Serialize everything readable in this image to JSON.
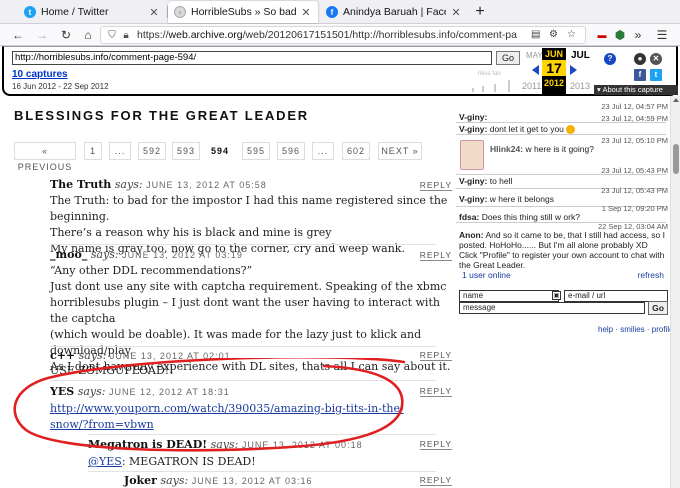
{
  "browser": {
    "tabs": [
      {
        "title": "Home / Twitter",
        "favicon": "twitter-icon"
      },
      {
        "title": "HorribleSubs » So bad yet so go",
        "favicon": "horriblesubs-icon"
      },
      {
        "title": "Anindya Baruah | Facebook",
        "favicon": "facebook-icon"
      }
    ],
    "new_tab": "+",
    "url_domain": "web.archive.org",
    "url_path": "/web/20120617151501/http://horriblesubs.info/comment-page-594/",
    "url_prefix": "https://"
  },
  "wayback": {
    "input_url": "http://horriblesubs.info/comment-page-594/",
    "go": "Go",
    "captures_label": "10 captures",
    "range": "16 Jun 2012 - 22 Sep 2012",
    "prev_month": "MAY",
    "cur_month": "JUN",
    "next_month": "JUL",
    "cur_day": "17",
    "prev_year": "2011",
    "cur_year": "2012",
    "next_year": "2013",
    "about": "About this capture"
  },
  "page": {
    "title": "BLESSINGS FOR THE GREAT LEADER",
    "pager": [
      "« PREVIOUS",
      "1",
      "...",
      "592",
      "593",
      "594",
      "595",
      "596",
      "...",
      "602",
      "NEXT »"
    ],
    "current_page": "594"
  },
  "comments": [
    {
      "author": "The Truth",
      "says": "says:",
      "date": "JUNE 13, 2012 AT 05:58",
      "reply": "REPLY",
      "lines": [
        "The Truth: to bad for the impostor I had this name registered since the beginning.",
        "There’s a reason why his is black and mine is grey",
        "My name is gray too, now go to the corner, cry and weep wank."
      ]
    },
    {
      "author": "_moo_",
      "says": "says:",
      "date": "JUNE 13, 2012 AT 03:19",
      "reply": "REPLY",
      "lines": [
        "“Any other DDL recommendations?”",
        "Just dont use any site with captcha requirement. Speaking of the xbmc",
        "horriblesubs plugin – I just dont want the user having to interact with the captcha",
        "(which would be doable). It was made for the lazy just to klick and download/play.",
        "As I dont have any experience with DL sites, thats all I can say about it."
      ]
    },
    {
      "author": "c++",
      "says": "says:",
      "date": "JUNE 13, 2012 AT 02:01",
      "reply": "REPLY",
      "lines": [
        "USE ZOMGUPLOAD!!"
      ]
    },
    {
      "author": "YES",
      "says": "says:",
      "date": "JUNE 12, 2012 AT 18:31",
      "reply": "REPLY",
      "link_lines": [
        "http://www.youporn.com/watch/390035/amazing-big-tits-in-the-",
        "snow/?from=vbwn"
      ]
    },
    {
      "author": "Megatron is DEAD!",
      "says": "says:",
      "date": "JUNE 13, 2012 AT 00:18",
      "reply": "REPLY",
      "mention": "@YES",
      "text_after_mention": ": MEGATRON IS DEAD!"
    },
    {
      "author": "Joker",
      "says": "says:",
      "date": "JUNE 13, 2012 AT 03:16",
      "reply": "REPLY"
    }
  ],
  "shoutbox": {
    "messages": [
      {
        "name": "V-giny:",
        "text": "",
        "time": "23 Jul 12, 04:57 PM"
      },
      {
        "name": "V-giny:",
        "text": "dont let it get to you",
        "time": "23 Jul 12, 04:59 PM"
      },
      {
        "name": "Hlink24:",
        "text": "w here is it going?",
        "time": "23 Jul 12, 05:10 PM"
      },
      {
        "name": "V-giny:",
        "text": "to hell",
        "time": "23 Jul 12, 05:43 PM"
      },
      {
        "name": "V-giny:",
        "text": "w here it belongs",
        "time": "23 Jul 12, 05:43 PM"
      },
      {
        "name": "fdsa:",
        "text": "Does this thing still w ork?",
        "time": "1 Sep 12, 09:20 PM"
      },
      {
        "name": "Anon:",
        "text": "And so it came to be, that I still had access, so I posted. HoHoHo...... But I'm all alone probably XD",
        "time": "22 Sep 12, 03:04 AM"
      }
    ],
    "notice": "Click \"Profile\" to register your own account to chat with the Great Leader.",
    "online": "1 user online",
    "refresh": "refresh",
    "name_placeholder": "name",
    "email_placeholder": "e-mail / url",
    "message_placeholder": "message",
    "go": "Go",
    "links": "help · smilies · profile"
  },
  "colors": {
    "link": "#1a3c9e",
    "annotation": "#e02020",
    "wayback_yellow": "#ffd400"
  }
}
